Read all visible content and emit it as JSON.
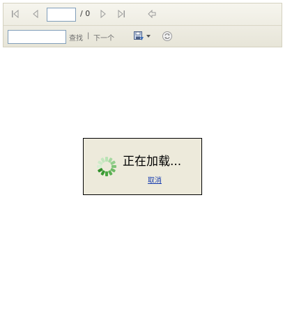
{
  "toolbar": {
    "nav": {
      "first_page_icon": "first-page-icon",
      "prev_page_icon": "prev-page-icon",
      "next_page_icon": "next-page-icon",
      "last_page_icon": "last-page-icon",
      "back_icon": "back-icon",
      "page_value": "",
      "page_total": "/ 0"
    },
    "find": {
      "search_value": "",
      "find_label": "查找",
      "separator": "|",
      "next_label": "下一个",
      "export_icon": "save-icon",
      "export_dropdown_icon": "chevron-down-icon",
      "refresh_icon": "refresh-icon"
    }
  },
  "loading": {
    "message": "正在加载...",
    "cancel_label": "取消",
    "spinner_icon": "spinner-icon",
    "spinner_color": "#4caf50"
  },
  "colors": {
    "toolbar_bg": "#ece9d8",
    "dialog_bg": "#edeadb",
    "link": "#1a3fb0"
  }
}
